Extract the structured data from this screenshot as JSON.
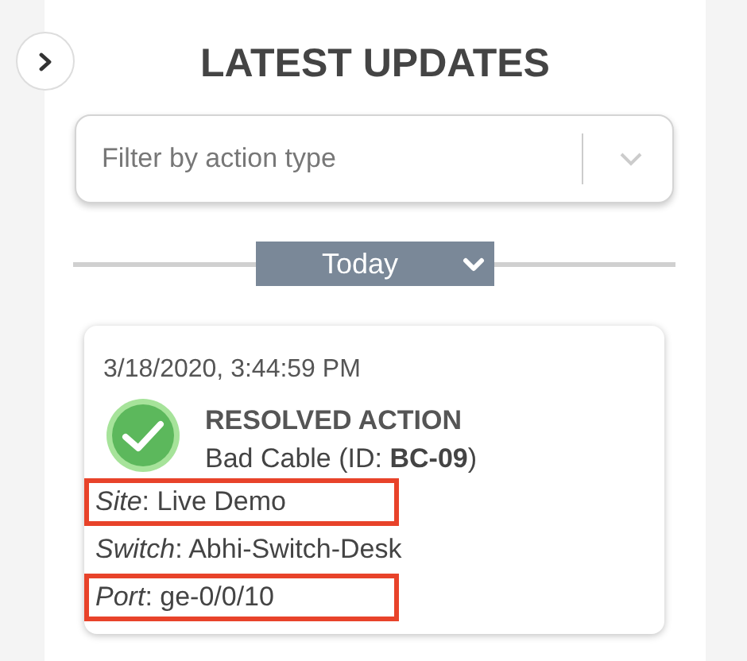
{
  "title": "LATEST UPDATES",
  "filter": {
    "placeholder": "Filter by action type"
  },
  "date_group": {
    "label": "Today",
    "expanded": true
  },
  "updates": [
    {
      "timestamp": "3/18/2020, 3:44:59 PM",
      "kind": "resolved",
      "heading": "RESOLVED ACTION",
      "summary": "Bad Cable (ID: **BC-09**)",
      "details": [
        {
          "label": "Site",
          "value": ": Live Demo",
          "highlighted": true
        },
        {
          "label": "Switch",
          "value": ": Abhi-Switch-Desk",
          "highlighted": false
        },
        {
          "label": "Port",
          "value": ": ge-0/0/10",
          "highlighted": true
        }
      ]
    }
  ]
}
